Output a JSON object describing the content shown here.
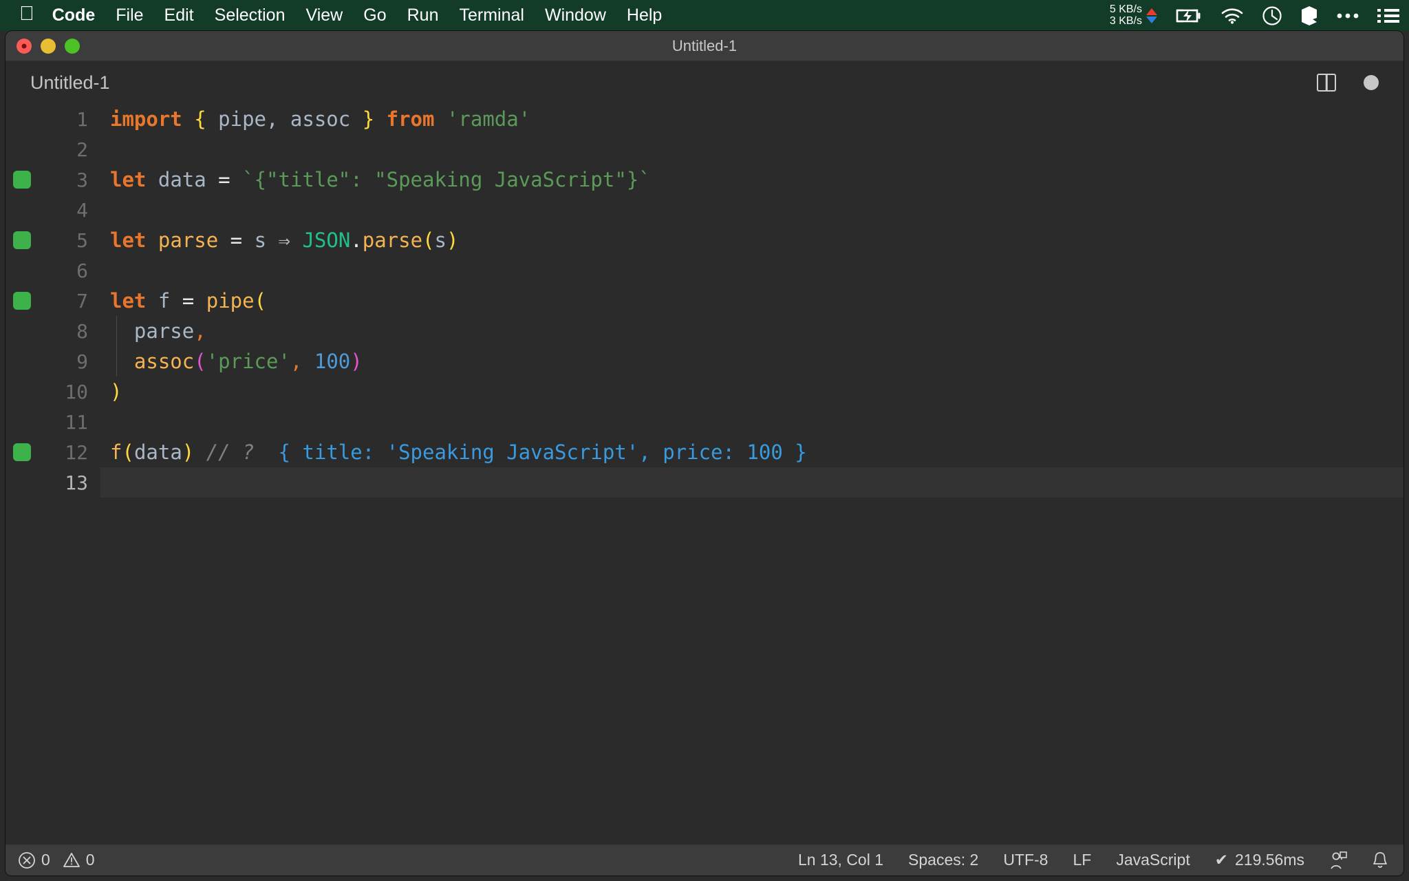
{
  "menubar": {
    "apple_icon": "apple-logo-icon",
    "items": [
      {
        "label": "Code",
        "bold": true
      },
      {
        "label": "File",
        "bold": false
      },
      {
        "label": "Edit",
        "bold": false
      },
      {
        "label": "Selection",
        "bold": false
      },
      {
        "label": "View",
        "bold": false
      },
      {
        "label": "Go",
        "bold": false
      },
      {
        "label": "Run",
        "bold": false
      },
      {
        "label": "Terminal",
        "bold": false
      },
      {
        "label": "Window",
        "bold": false
      },
      {
        "label": "Help",
        "bold": false
      }
    ],
    "tray": {
      "upload_speed": "5 KB/s",
      "download_speed": "3 KB/s",
      "icons": [
        "battery-charging-icon",
        "wifi-icon",
        "clock-icon",
        "cube-icon",
        "ellipsis-icon",
        "list-icon"
      ]
    },
    "background_color": "#123b28"
  },
  "window": {
    "title": "Untitled-1",
    "traffic_lights": [
      "close-button",
      "minimize-button",
      "maximize-button"
    ]
  },
  "tabbar": {
    "active_tab": "Untitled-1",
    "actions": [
      "split-editor-icon",
      "unsaved-dot-icon"
    ]
  },
  "editor": {
    "background_color": "#2b2b2b",
    "lines": [
      {
        "num": "1",
        "marker": false,
        "current": false
      },
      {
        "num": "2",
        "marker": false,
        "current": false
      },
      {
        "num": "3",
        "marker": true,
        "current": false
      },
      {
        "num": "4",
        "marker": false,
        "current": false
      },
      {
        "num": "5",
        "marker": true,
        "current": false
      },
      {
        "num": "6",
        "marker": false,
        "current": false
      },
      {
        "num": "7",
        "marker": true,
        "current": false
      },
      {
        "num": "8",
        "marker": false,
        "current": false
      },
      {
        "num": "9",
        "marker": false,
        "current": false
      },
      {
        "num": "10",
        "marker": false,
        "current": false
      },
      {
        "num": "11",
        "marker": false,
        "current": false
      },
      {
        "num": "12",
        "marker": true,
        "current": false
      },
      {
        "num": "13",
        "marker": false,
        "current": true
      }
    ],
    "code": {
      "l1_import": "import",
      "l1_brace_open": "{",
      "l1_names": " pipe, assoc ",
      "l1_brace_close": "}",
      "l1_from": "from",
      "l1_module": "'ramda'",
      "l3_let": "let",
      "l3_name": "data",
      "l3_eq": "=",
      "l3_template": "`{\"title\": \"Speaking JavaScript\"}`",
      "l5_let": "let",
      "l5_name": "parse",
      "l5_eq": "=",
      "l5_param": "s",
      "l5_arrow": "⇒",
      "l5_class": "JSON",
      "l5_dot": ".",
      "l5_method": "parse",
      "l5_paren_open": "(",
      "l5_arg": "s",
      "l5_paren_close": ")",
      "l7_let": "let",
      "l7_name": "f",
      "l7_eq": "=",
      "l7_fn": "pipe",
      "l7_paren": "(",
      "l8_arg": "parse",
      "l8_comma": ",",
      "l9_fn": "assoc",
      "l9_paren_open": "(",
      "l9_str": "'price'",
      "l9_comma": ",",
      "l9_num": "100",
      "l9_paren_close": ")",
      "l10_paren": ")",
      "l12_fn": "f",
      "l12_paren_open": "(",
      "l12_arg": "data",
      "l12_paren_close": ")",
      "l12_comment": "// ?",
      "l12_result": "{ title: 'Speaking JavaScript', price: 100 }"
    }
  },
  "statusbar": {
    "error_icon": "error-circle-icon",
    "error_count": "0",
    "warning_icon": "warning-triangle-icon",
    "warning_count": "0",
    "cursor_position": "Ln 13, Col 1",
    "indentation": "Spaces: 2",
    "encoding": "UTF-8",
    "eol": "LF",
    "language": "JavaScript",
    "run_status_check": "✔",
    "run_time": "219.56ms",
    "right_icons": [
      "live-share-icon",
      "bell-icon"
    ]
  }
}
